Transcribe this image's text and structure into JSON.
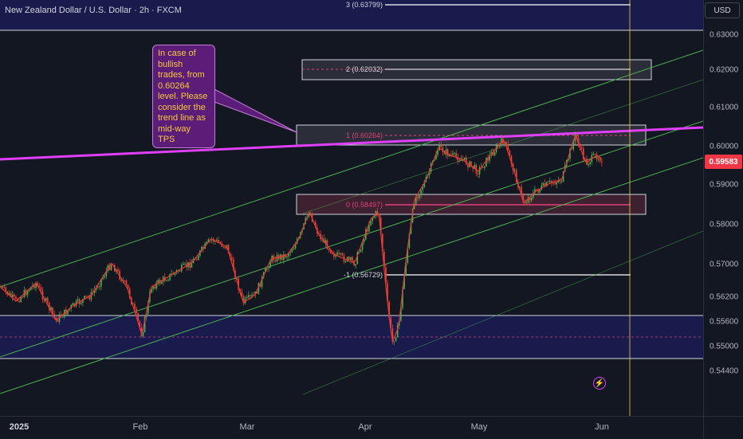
{
  "header": {
    "symbol_title": "New Zealand Dollar / U.S. Dollar · 2h · FXCM",
    "currency": "USD"
  },
  "price_scale": {
    "labels": [
      "0.63000",
      "0.62000",
      "0.61000",
      "0.60000",
      "0.59000",
      "0.58000",
      "0.57000",
      "0.56200",
      "0.55600",
      "0.55000",
      "0.54400"
    ],
    "last_price": "0.59583"
  },
  "time_scale": {
    "labels": [
      "2025",
      "Feb",
      "Mar",
      "Apr",
      "May",
      "Jun"
    ]
  },
  "annotation": {
    "text": "In case of bullish trades, from 0.60264 level. Please consider the trend line as mid-way TPS"
  },
  "fib_levels": [
    {
      "label": "3 (0.63799)",
      "value": 0.63799
    },
    {
      "label": "2 (0.62032)",
      "value": 0.62032
    },
    {
      "label": "1 (0.60264)",
      "value": 0.60264
    },
    {
      "label": "0 (0.58497)",
      "value": 0.58497
    },
    {
      "label": "-1 (0.56729)",
      "value": 0.56729
    }
  ],
  "colors": {
    "background": "#131722",
    "up_candle": "#4caf50",
    "down_candle": "#f44336",
    "trend_line": "#e040fb",
    "channel": "#4caf50",
    "callout_bg": "#5b1d77",
    "callout_text": "#f7c83d",
    "last_price": "#f23645",
    "zone": "#1e1e5a"
  },
  "icons": {
    "lightning": "lightning-icon"
  }
}
